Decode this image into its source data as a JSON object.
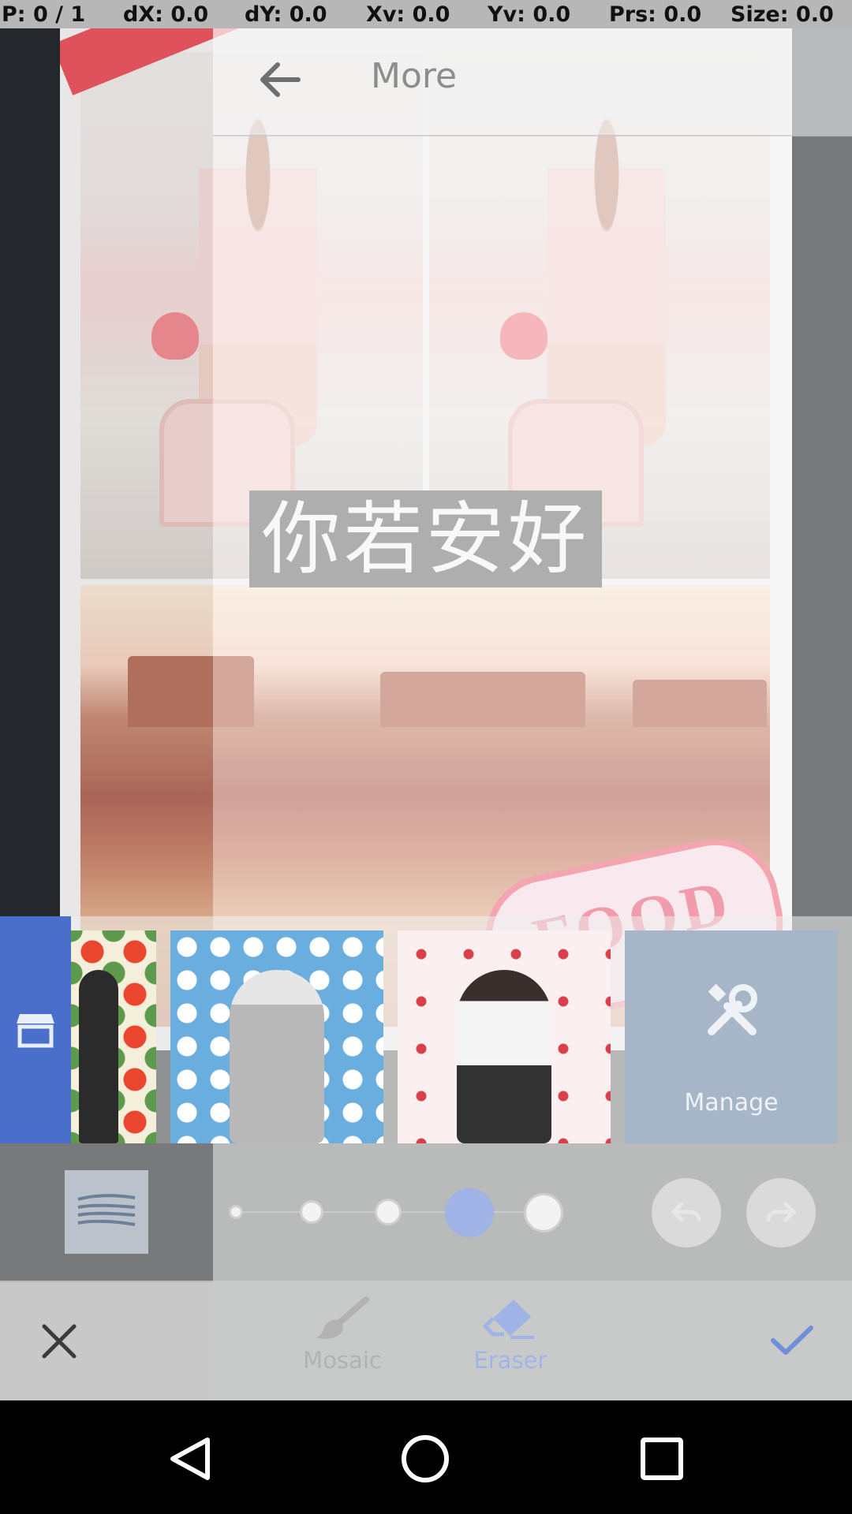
{
  "debug_bar": {
    "pointer": "P: 0 / 1",
    "dx": "dX: 0.0",
    "dy": "dY: 0.0",
    "xv": "Xv: 0.0",
    "yv": "Yv: 0.0",
    "prs": "Prs: 0.0",
    "size": "Size: 0.0"
  },
  "header": {
    "title": "More",
    "back_icon": "arrow-left-icon"
  },
  "canvas": {
    "text_overlay": "你若安好",
    "sticker_text": "FOOD"
  },
  "sticker_tray": {
    "store_icon": "store-icon",
    "manage_label": "Manage",
    "manage_icon": "wrench-screwdriver-icon"
  },
  "brush": {
    "sizes": 5,
    "selected_size_index": 3,
    "undo_icon": "undo-icon",
    "redo_icon": "redo-icon"
  },
  "toolbar": {
    "cancel_icon": "close-icon",
    "mosaic_label": "Mosaic",
    "eraser_label": "Eraser",
    "confirm_icon": "check-icon",
    "active_tool": "Eraser"
  },
  "colors": {
    "accent": "#4a6fcb",
    "accent_light": "#9fb3e6",
    "manage_tile": "#a6b6c8"
  }
}
